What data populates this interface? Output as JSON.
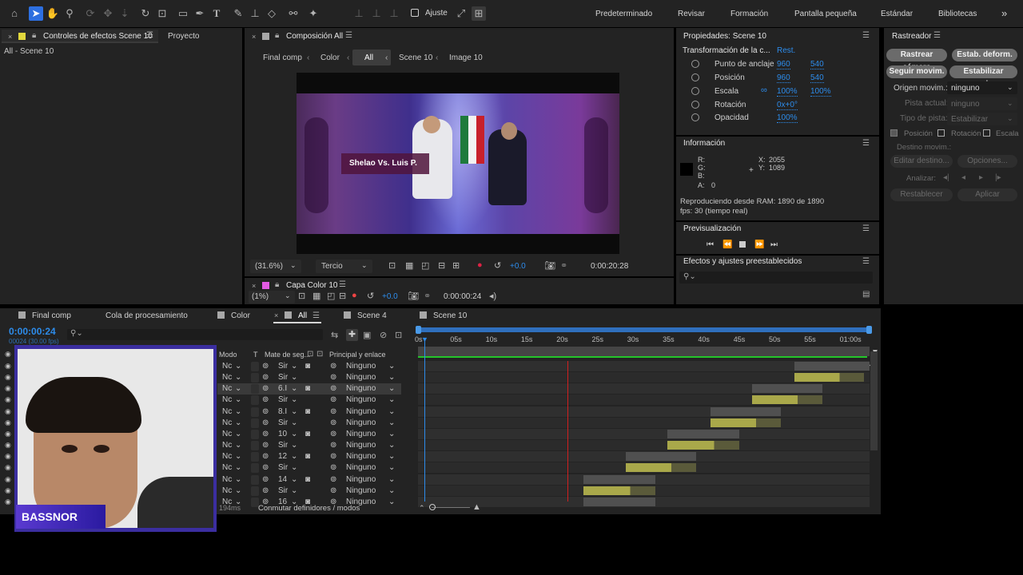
{
  "toolbar": {
    "snap_label": "Ajuste",
    "workspaces": [
      "Predeterminado",
      "Revisar",
      "Formación",
      "Pantalla pequeña",
      "Estándar",
      "Bibliotecas"
    ],
    "more": "»"
  },
  "effects_panel": {
    "tab_label": "Controles de efectos Scene 10",
    "project_tab": "Proyecto",
    "breadcrumb": "All - Scene 10"
  },
  "composition": {
    "tab_label": "Composición All",
    "crumbs": [
      "Final comp",
      "Color",
      "All",
      "Scene 10",
      "Image 10"
    ],
    "overlay_text": "Shelao Vs. Luis P.",
    "zoom": "(31.6%)",
    "resolution": "Tercio",
    "exposure": "+0.0",
    "timecode": "0:00:20:28"
  },
  "layer_panel": {
    "tab_label": "Capa Color 10",
    "zoom": "(1%)",
    "exposure": "+0.0",
    "timecode": "0:00:00:24"
  },
  "properties": {
    "title": "Propiedades: Scene 10",
    "section": "Transformación de la c...",
    "reset": "Rest.",
    "rows": [
      {
        "label": "Punto de anclaje",
        "v1": "960",
        "v2": "540"
      },
      {
        "label": "Posición",
        "v1": "960",
        "v2": "540"
      },
      {
        "label": "Escala",
        "v1": "100%",
        "v2": "100%"
      },
      {
        "label": "Rotación",
        "v1": "0x+0°",
        "v2": ""
      },
      {
        "label": "Opacidad",
        "v1": "100%",
        "v2": ""
      }
    ]
  },
  "info": {
    "title": "Información",
    "r": "R:",
    "g": "G:",
    "b": "B:",
    "a": "A:",
    "a_val": "0",
    "x": "X:",
    "x_val": "2055",
    "y": "Y:",
    "y_val": "1089",
    "ram": "Reproduciendo desde RAM: 1890 de 1890",
    "fps": "fps: 30 (tiempo real)"
  },
  "preview": {
    "title": "Previsualización"
  },
  "effects_presets": {
    "title": "Efectos y ajustes preestablecidos",
    "search_placeholder": ""
  },
  "tracker": {
    "title": "Rastreador",
    "btn_camera": "Rastrear cámara",
    "btn_deform": "Estab. deform.",
    "btn_follow": "Seguir movim.",
    "btn_stabilize": "Estabilizar movim.",
    "origin_label": "Origen movim.:",
    "origin_value": "ninguno",
    "current_label": "Pista actual:",
    "current_value": "ninguno",
    "type_label": "Tipo de pista:",
    "type_value": "Estabilizar",
    "chk_position": "Posición",
    "chk_rotation": "Rotación",
    "chk_scale": "Escala",
    "target_label": "Destino movim.:",
    "edit_target": "Editar destino...",
    "options": "Opciones...",
    "analyze": "Analizar:",
    "reset": "Restablecer",
    "apply": "Aplicar"
  },
  "timeline": {
    "tabs": [
      "Final comp",
      "Cola de procesamiento",
      "Color",
      "All",
      "Scene 4",
      "Scene 10"
    ],
    "timecode": "0:00:00:24",
    "timecode_sub": "00024 (30.00 fps)",
    "col_mode": "Modo",
    "col_t": "T",
    "col_matte": "Mate de seg...",
    "col_parent": "Principal y enlace",
    "ruler": [
      "0s",
      "05s",
      "10s",
      "15s",
      "20s",
      "25s",
      "30s",
      "35s",
      "40s",
      "45s",
      "50s",
      "55s",
      "01:00s"
    ],
    "footer_ms": "194ms",
    "footer_toggle": "Conmutar definidores / modos",
    "rows": [
      {
        "mode": "Nc",
        "matte": "Sir",
        "parent": "Ninguno"
      },
      {
        "mode": "Nc",
        "matte": "Sir",
        "parent": "Ninguno"
      },
      {
        "mode": "Nc",
        "matte": "6.I",
        "parent": "Ninguno"
      },
      {
        "mode": "Nc",
        "matte": "Sir",
        "parent": "Ninguno"
      },
      {
        "mode": "Nc",
        "matte": "8.I",
        "parent": "Ninguno"
      },
      {
        "mode": "Nc",
        "matte": "Sir",
        "parent": "Ninguno"
      },
      {
        "mode": "Nc",
        "matte": "10",
        "parent": "Ninguno"
      },
      {
        "mode": "Nc",
        "matte": "Sir",
        "parent": "Ninguno"
      },
      {
        "mode": "Nc",
        "matte": "12",
        "parent": "Ninguno"
      },
      {
        "mode": "Nc",
        "matte": "Sir",
        "parent": "Ninguno"
      },
      {
        "mode": "Nc",
        "matte": "14",
        "parent": "Ninguno"
      },
      {
        "mode": "Nc",
        "matte": "Sir",
        "parent": "Ninguno"
      },
      {
        "mode": "Nc",
        "matte": "16",
        "parent": "Ninguno"
      }
    ]
  },
  "webcam": {
    "name": "BASSNOR"
  },
  "colors": {
    "accent": "#2d8ceb",
    "track_bar": "#a9a84a",
    "track_bar_active": "#d9d94e",
    "playhead": "#d21f1f",
    "work_area": "#23c52a"
  }
}
